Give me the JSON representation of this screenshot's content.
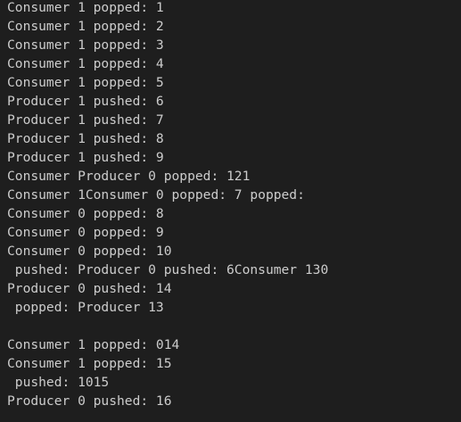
{
  "terminal": {
    "lines": [
      "Consumer 1 popped: 1",
      "Consumer 1 popped: 2",
      "Consumer 1 popped: 3",
      "Consumer 1 popped: 4",
      "Consumer 1 popped: 5",
      "Producer 1 pushed: 6",
      "Producer 1 pushed: 7",
      "Producer 1 pushed: 8",
      "Producer 1 pushed: 9",
      "Consumer Producer 0 popped: 121",
      "Consumer 1Consumer 0 popped: 7 popped:",
      "Consumer 0 popped: 8",
      "Consumer 0 popped: 9",
      "Consumer 0 popped: 10",
      " pushed: Producer 0 pushed: 6Consumer 130",
      "Producer 0 pushed: 14",
      " popped: Producer 13",
      "",
      "Consumer 1 popped: 014",
      "Consumer 1 popped: 15",
      " pushed: 1015",
      "Producer 0 pushed: 16"
    ],
    "colors": {
      "background": "#1e1e1e",
      "text": "#cccccc"
    }
  }
}
